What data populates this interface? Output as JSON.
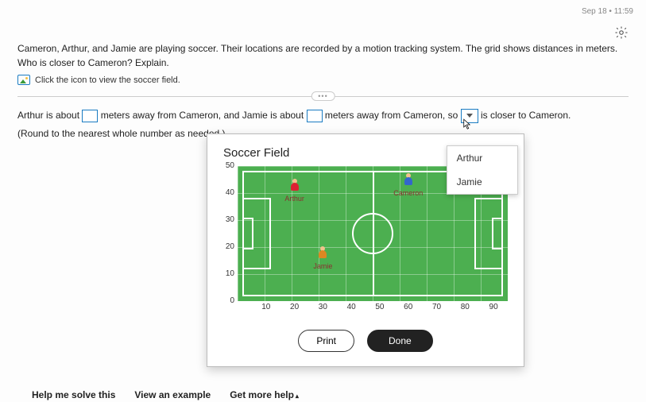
{
  "topbar": {
    "timestamp": "Sep 18 • 11:59"
  },
  "question": {
    "text": "Cameron, Arthur, and Jamie are playing soccer. Their locations are recorded by a motion tracking system. The grid shows distances in meters. Who is closer to Cameron? Explain.",
    "link_text": "Click the icon to view the soccer field."
  },
  "answer": {
    "part1": "Arthur is about",
    "part2": "meters away from Cameron, and Jamie is about",
    "part3": "meters away from Cameron, so",
    "part4": "is closer to Cameron.",
    "note": "(Round to the nearest whole number as needed.)"
  },
  "dropdown": {
    "options": [
      "Arthur",
      "Jamie"
    ]
  },
  "modal": {
    "title": "Soccer Field",
    "print": "Print",
    "done": "Done"
  },
  "chart_data": {
    "type": "scatter",
    "title": "Soccer Field",
    "xlabel": "",
    "ylabel": "",
    "xlim": [
      0,
      95
    ],
    "ylim": [
      0,
      50
    ],
    "x_ticks": [
      10,
      20,
      30,
      40,
      50,
      60,
      70,
      80,
      90
    ],
    "y_ticks": [
      0,
      10,
      20,
      30,
      40,
      50
    ],
    "series": [
      {
        "name": "Arthur",
        "x": 20,
        "y": 40,
        "color": "#d23"
      },
      {
        "name": "Jamie",
        "x": 30,
        "y": 15,
        "color": "#d82"
      },
      {
        "name": "Cameron",
        "x": 60,
        "y": 42,
        "color": "#36c"
      }
    ]
  },
  "footer": {
    "help": "Help me solve this",
    "example": "View an example",
    "more": "Get more help"
  }
}
